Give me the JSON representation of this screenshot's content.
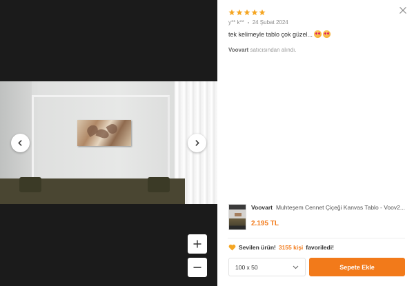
{
  "gallery": {
    "prev_icon": "chevron-left-icon",
    "next_icon": "chevron-right-icon",
    "zoom_in_icon": "plus-icon",
    "zoom_out_icon": "minus-icon"
  },
  "review": {
    "rating": 5,
    "max_rating": 5,
    "star_color": "#f5a623",
    "author": "y** k**",
    "date": "24 Şubat 2024",
    "text": "tek kelimeyle tablo çok güzel...",
    "emoji_icons": [
      "star-struck-emoji-icon",
      "star-struck-emoji-icon"
    ],
    "seller_name": "Voovart",
    "seller_suffix": "satıcısından alındı."
  },
  "product": {
    "brand": "Voovart",
    "name": "Muhteşem Cennet Çiçeği Kanvas Tablo - Voov2...",
    "price": "2.195 TL",
    "accent_color": "#f27a1a"
  },
  "favorite": {
    "label": "Sevilen ürün!",
    "count_text": "3155 kişi",
    "suffix": "favoriledi!"
  },
  "size_select": {
    "value": "100 x 50"
  },
  "actions": {
    "add_to_cart": "Sepete Ekle",
    "close_icon": "close-icon"
  }
}
